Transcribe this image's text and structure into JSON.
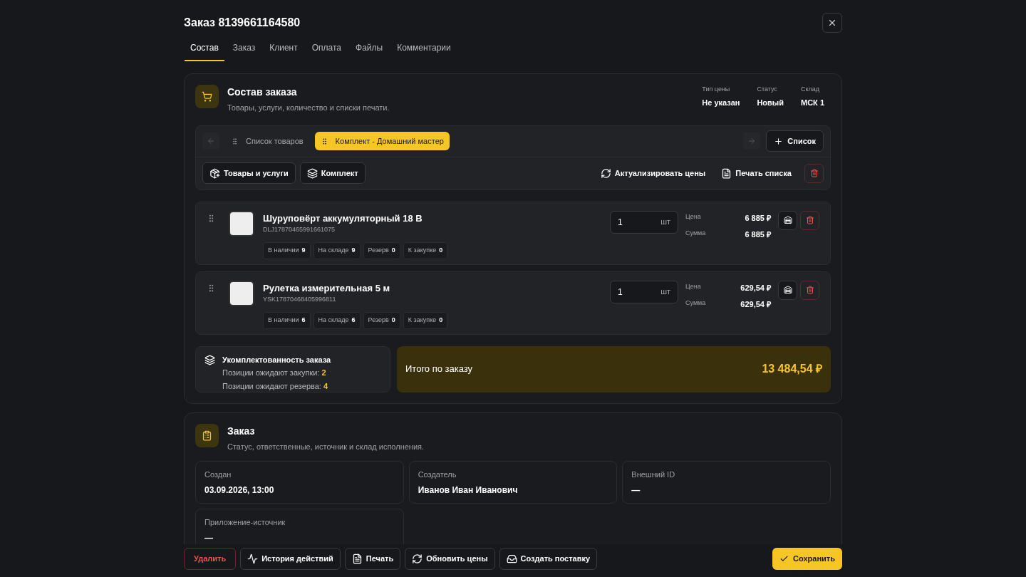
{
  "dialog": {
    "title": "Заказ 8139661164580"
  },
  "tabs": [
    {
      "label": "Состав",
      "selected": true
    },
    {
      "label": "Заказ",
      "selected": false
    },
    {
      "label": "Клиент",
      "selected": false
    },
    {
      "label": "Оплата",
      "selected": false
    },
    {
      "label": "Файлы",
      "selected": false
    },
    {
      "label": "Комментарии",
      "selected": false
    }
  ],
  "composition": {
    "title": "Состав заказа",
    "subtitle": "Товары, услуги, количество и списки печати.",
    "meta": [
      {
        "label": "Тип цены",
        "value": "Не указан"
      },
      {
        "label": "Статус",
        "value": "Новый"
      },
      {
        "label": "Склад",
        "value": "МСК 1"
      }
    ],
    "lists": [
      {
        "label": "Список товаров",
        "selected": false
      },
      {
        "label": "Комплект - Домашний мастер",
        "selected": true
      }
    ],
    "add_list_button": "Список",
    "tools_left": [
      {
        "kind": "products",
        "label": "Товары и услуги"
      },
      {
        "kind": "kit",
        "label": "Комплект"
      }
    ],
    "tools_right": [
      {
        "kind": "refresh",
        "label": "Актуализировать цены"
      },
      {
        "kind": "print",
        "label": "Печать списка"
      }
    ],
    "items": [
      {
        "name": "Шуруповёрт аккумуляторный 18 В",
        "sku": "DLJ17870465991661075",
        "qty": "1",
        "unit": "шт",
        "price_label": "Цена",
        "price": "6 885 ₽",
        "sum_label": "Сумма",
        "sum": "6 885 ₽",
        "stocks": [
          {
            "label": "В наличии",
            "value": "9"
          },
          {
            "label": "На складе",
            "value": "9"
          },
          {
            "label": "Резерв",
            "value": "0"
          },
          {
            "label": "К закупке",
            "value": "0"
          }
        ]
      },
      {
        "name": "Рулетка измерительная 5 м",
        "sku": "YSK17870468405996811",
        "qty": "1",
        "unit": "шт",
        "price_label": "Цена",
        "price": "629,54 ₽",
        "sum_label": "Сумма",
        "sum": "629,54 ₽",
        "stocks": [
          {
            "label": "В наличии",
            "value": "6"
          },
          {
            "label": "На складе",
            "value": "6"
          },
          {
            "label": "Резерв",
            "value": "0"
          },
          {
            "label": "К закупке",
            "value": "0"
          }
        ]
      }
    ],
    "completeness": {
      "title": "Укомплектованность заказа",
      "lines": [
        {
          "label": "Позиции ожидают закупки:",
          "value": "2"
        },
        {
          "label": "Позиции ожидают резерва:",
          "value": "4"
        }
      ]
    },
    "total": {
      "label": "Итого по заказу",
      "value": "13 484,54 ₽"
    }
  },
  "order": {
    "title": "Заказ",
    "subtitle": "Статус, ответственные, источник и склад исполнения.",
    "fields": [
      {
        "label": "Создан",
        "value": "03.09.2026, 13:00"
      },
      {
        "label": "Создатель",
        "value": "Иванов Иван Иванович"
      },
      {
        "label": "Внешний ID",
        "value": "—"
      },
      {
        "label": "Приложение-источник",
        "value": "—"
      }
    ]
  },
  "footer": {
    "delete": "Удалить",
    "actions": [
      {
        "kind": "history",
        "label": "История действий"
      },
      {
        "kind": "print",
        "label": "Печать"
      },
      {
        "kind": "refresh",
        "label": "Обновить цены"
      },
      {
        "kind": "shipment",
        "label": "Создать поставку"
      }
    ],
    "save": "Сохранить"
  }
}
